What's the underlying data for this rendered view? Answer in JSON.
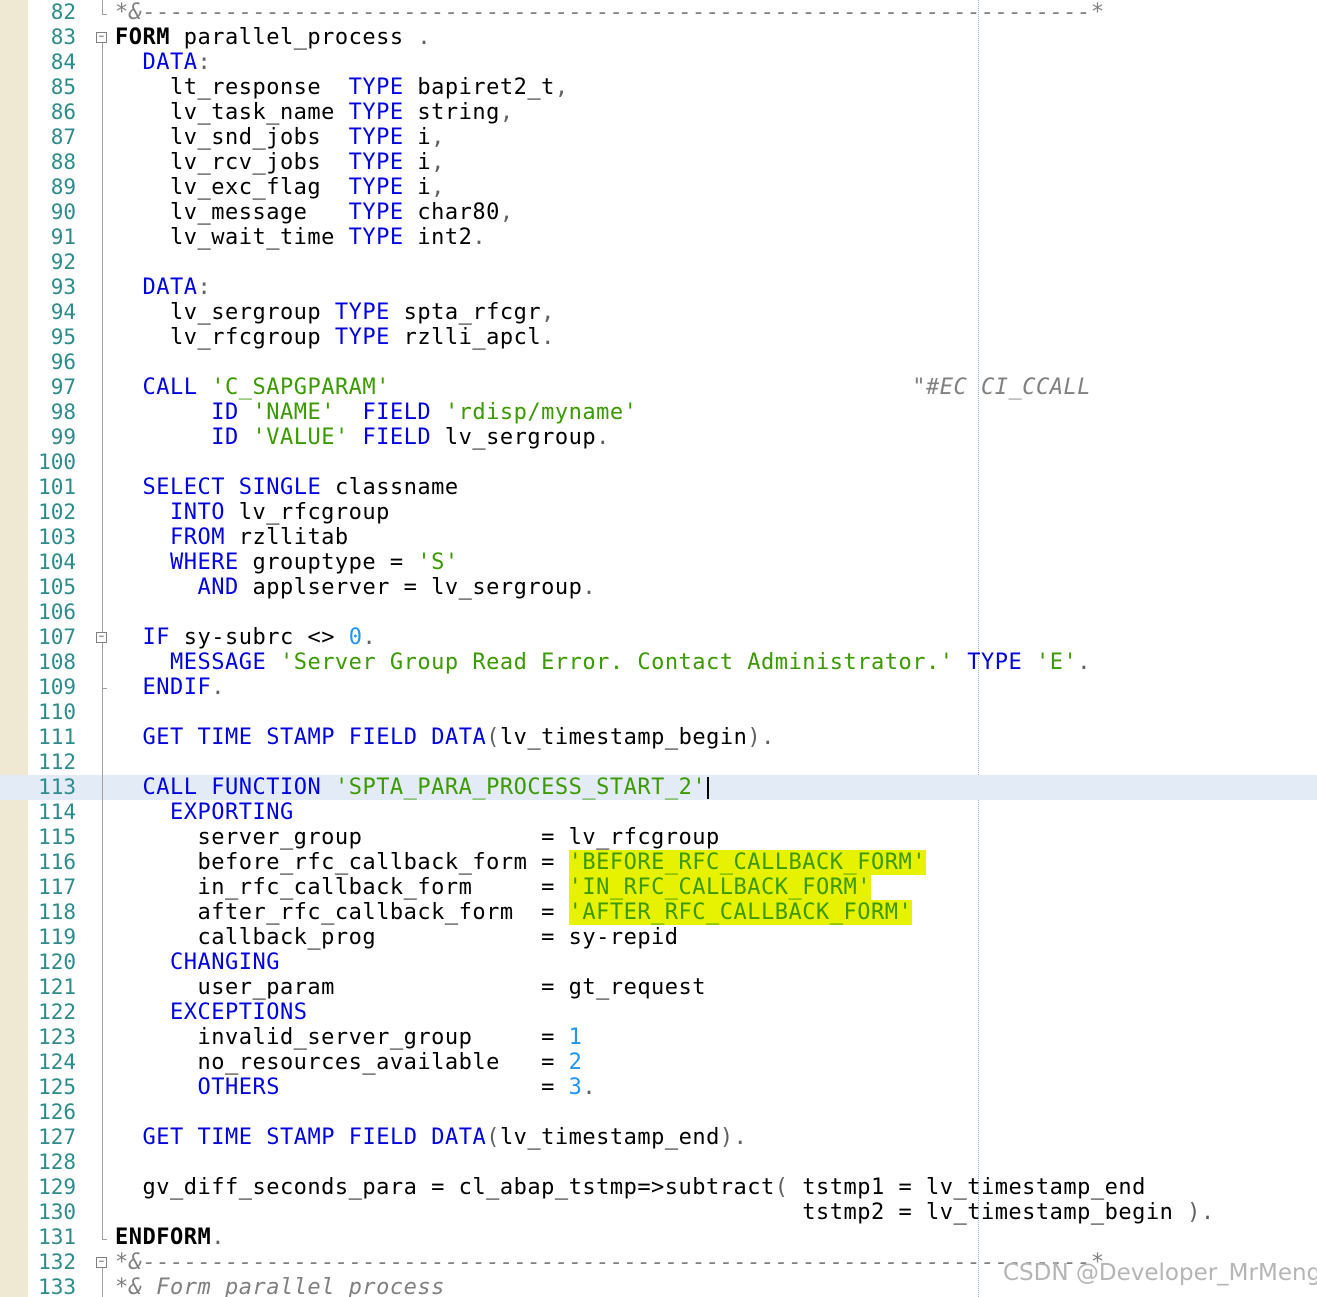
{
  "editor": {
    "language": "ABAP",
    "current_line": 113,
    "colors": {
      "keyword": "#0000e0",
      "string": "#3a9a00",
      "number": "#2196f3",
      "comment": "#808080",
      "line_number": "#2e8b8b",
      "highlight": "#e6f200",
      "current_line_bg": "#e3ebf7"
    },
    "lines": [
      {
        "n": "82",
        "t": "*&---------------------------------------------------------------------*"
      },
      {
        "n": "83",
        "t": "FORM parallel_process ."
      },
      {
        "n": "84",
        "t": "  DATA:"
      },
      {
        "n": "85",
        "t": "    lt_response  TYPE bapiret2_t,"
      },
      {
        "n": "86",
        "t": "    lv_task_name TYPE string,"
      },
      {
        "n": "87",
        "t": "    lv_snd_jobs  TYPE i,"
      },
      {
        "n": "88",
        "t": "    lv_rcv_jobs  TYPE i,"
      },
      {
        "n": "89",
        "t": "    lv_exc_flag  TYPE i,"
      },
      {
        "n": "90",
        "t": "    lv_message   TYPE char80,"
      },
      {
        "n": "91",
        "t": "    lv_wait_time TYPE int2."
      },
      {
        "n": "92",
        "t": ""
      },
      {
        "n": "93",
        "t": "  DATA:"
      },
      {
        "n": "94",
        "t": "    lv_sergroup TYPE spta_rfcgr,"
      },
      {
        "n": "95",
        "t": "    lv_rfcgroup TYPE rzlli_apcl."
      },
      {
        "n": "96",
        "t": ""
      },
      {
        "n": "97",
        "t": "  CALL 'C_SAPGPARAM'                                      \"#EC CI_CCALL"
      },
      {
        "n": "98",
        "t": "       ID 'NAME'  FIELD 'rdisp/myname'"
      },
      {
        "n": "99",
        "t": "       ID 'VALUE' FIELD lv_sergroup."
      },
      {
        "n": "100",
        "t": ""
      },
      {
        "n": "101",
        "t": "  SELECT SINGLE classname"
      },
      {
        "n": "102",
        "t": "    INTO lv_rfcgroup"
      },
      {
        "n": "103",
        "t": "    FROM rzllitab"
      },
      {
        "n": "104",
        "t": "    WHERE grouptype = 'S'"
      },
      {
        "n": "105",
        "t": "      AND applserver = lv_sergroup."
      },
      {
        "n": "106",
        "t": ""
      },
      {
        "n": "107",
        "t": "  IF sy-subrc <> 0."
      },
      {
        "n": "108",
        "t": "    MESSAGE 'Server Group Read Error. Contact Administrator.' TYPE 'E'."
      },
      {
        "n": "109",
        "t": "  ENDIF."
      },
      {
        "n": "110",
        "t": ""
      },
      {
        "n": "111",
        "t": "  GET TIME STAMP FIELD DATA(lv_timestamp_begin)."
      },
      {
        "n": "112",
        "t": ""
      },
      {
        "n": "113",
        "t": "  CALL FUNCTION 'SPTA_PARA_PROCESS_START_2'"
      },
      {
        "n": "114",
        "t": "    EXPORTING"
      },
      {
        "n": "115",
        "t": "      server_group             = lv_rfcgroup"
      },
      {
        "n": "116",
        "t": "      before_rfc_callback_form = 'BEFORE_RFC_CALLBACK_FORM'"
      },
      {
        "n": "117",
        "t": "      in_rfc_callback_form     = 'IN_RFC_CALLBACK_FORM'"
      },
      {
        "n": "118",
        "t": "      after_rfc_callback_form  = 'AFTER_RFC_CALLBACK_FORM'"
      },
      {
        "n": "119",
        "t": "      callback_prog            = sy-repid"
      },
      {
        "n": "120",
        "t": "    CHANGING"
      },
      {
        "n": "121",
        "t": "      user_param               = gt_request"
      },
      {
        "n": "122",
        "t": "    EXCEPTIONS"
      },
      {
        "n": "123",
        "t": "      invalid_server_group     = 1"
      },
      {
        "n": "124",
        "t": "      no_resources_available   = 2"
      },
      {
        "n": "125",
        "t": "      OTHERS                   = 3."
      },
      {
        "n": "126",
        "t": ""
      },
      {
        "n": "127",
        "t": "  GET TIME STAMP FIELD DATA(lv_timestamp_end)."
      },
      {
        "n": "128",
        "t": ""
      },
      {
        "n": "129",
        "t": "  gv_diff_seconds_para = cl_abap_tstmp=>subtract( tstmp1 = lv_timestamp_end"
      },
      {
        "n": "130",
        "t": "                                                  tstmp2 = lv_timestamp_begin )."
      },
      {
        "n": "131",
        "t": "ENDFORM."
      },
      {
        "n": "132",
        "t": "*&---------------------------------------------------------------------*"
      },
      {
        "n": "133",
        "t": "*& Form parallel_process"
      }
    ]
  },
  "watermark": "CSDN @Developer_MrMeng"
}
